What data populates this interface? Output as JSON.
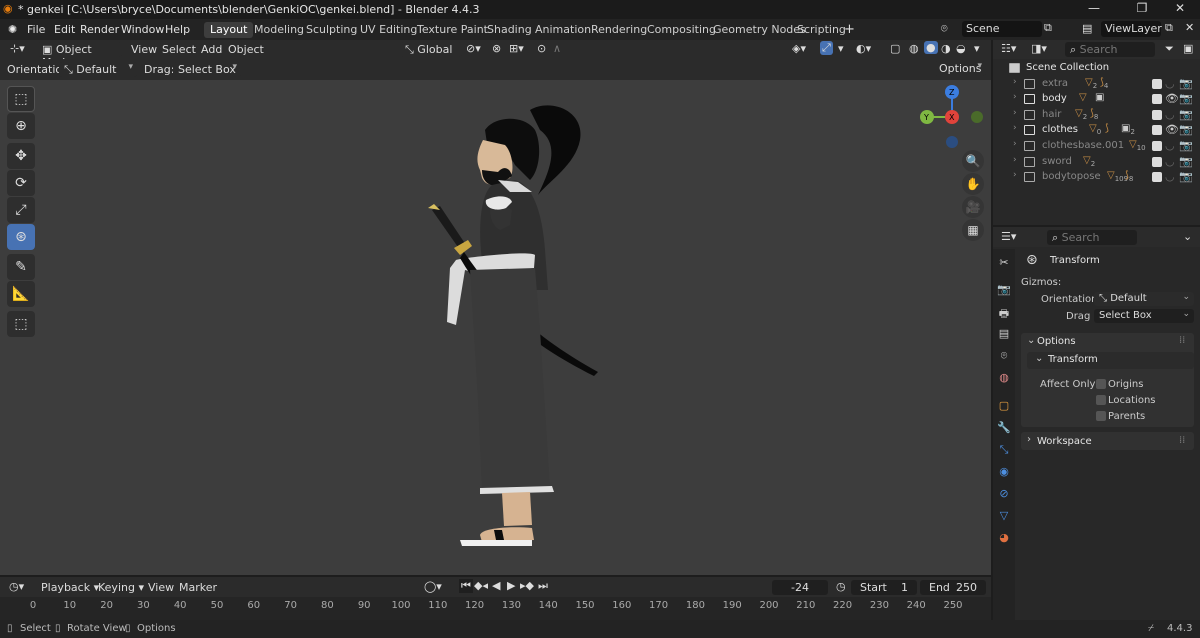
{
  "window": {
    "title": "* genkei [C:\\Users\\bryce\\Documents\\blender\\GenkiOC\\genkei.blend] - Blender 4.4.3",
    "minimize": "—",
    "maximize": "❐",
    "close": "✕"
  },
  "menu": {
    "file": "File",
    "edit": "Edit",
    "render": "Render",
    "window": "Window",
    "help": "Help"
  },
  "workspaces": [
    "Layout",
    "Modeling",
    "Sculpting",
    "UV Editing",
    "Texture Paint",
    "Shading",
    "Animation",
    "Rendering",
    "Compositing",
    "Geometry Nodes",
    "Scripting"
  ],
  "scene": {
    "name": "Scene",
    "view_layer": "ViewLayer"
  },
  "viewport_header": {
    "mode": "Object Mode",
    "view": "View",
    "select": "Select",
    "add": "Add",
    "object": "Object",
    "transform_orientation": "Global"
  },
  "tool_settings": {
    "orientation_label": "Orientation:",
    "orientation_value": "Default",
    "drag_label": "Drag:",
    "drag_value": "Select Box",
    "options": "Options"
  },
  "gizmo": {
    "z": "Z",
    "y": "Y",
    "x": "X"
  },
  "outliner": {
    "search_placeholder": "Search",
    "root": "Scene Collection",
    "items": [
      {
        "name": "extra",
        "badge1": "2",
        "badge2": "4",
        "visible": false
      },
      {
        "name": "body",
        "badge1": "",
        "badge2": "",
        "visible": true
      },
      {
        "name": "hair",
        "badge1": "2",
        "badge2": "8",
        "visible": false
      },
      {
        "name": "clothes",
        "badge1": "0",
        "badge2": "2",
        "visible": true
      },
      {
        "name": "clothesbase.001",
        "badge1": "",
        "badge2": "10",
        "visible": false
      },
      {
        "name": "sword",
        "badge1": "2",
        "badge2": "",
        "visible": false
      },
      {
        "name": "bodytopose",
        "badge1": "109",
        "badge2": "8",
        "visible": false
      }
    ]
  },
  "properties": {
    "search_placeholder": "Search",
    "tool_title": "Transform",
    "gizmos_label": "Gizmos:",
    "orientation_label": "Orientation",
    "orientation_value": "Default",
    "drag_label": "Drag",
    "drag_value": "Select Box",
    "options_panel": "Options",
    "transform_panel": "Transform",
    "affect_only": "Affect Only",
    "origins": "Origins",
    "locations": "Locations",
    "parents": "Parents",
    "workspace_panel": "Workspace"
  },
  "timeline": {
    "playback": "Playback",
    "keying": "Keying",
    "view": "View",
    "marker": "Marker",
    "current_frame": "-24",
    "start_label": "Start",
    "start_value": "1",
    "end_label": "End",
    "end_value": "250",
    "ticks": [
      "0",
      "10",
      "20",
      "30",
      "40",
      "50",
      "60",
      "70",
      "80",
      "90",
      "100",
      "110",
      "120",
      "130",
      "140",
      "150",
      "160",
      "170",
      "180",
      "190",
      "200",
      "210",
      "220",
      "230",
      "240",
      "250"
    ]
  },
  "status": {
    "select": "Select",
    "rotate": "Rotate View",
    "options": "Options",
    "version": "4.4.3"
  },
  "colors": {
    "accent": "#4772b3",
    "viewport_bg": "#3d3d3d",
    "x_axis": "#e0433b",
    "y_axis": "#7fb842",
    "z_axis": "#3b7de0"
  }
}
